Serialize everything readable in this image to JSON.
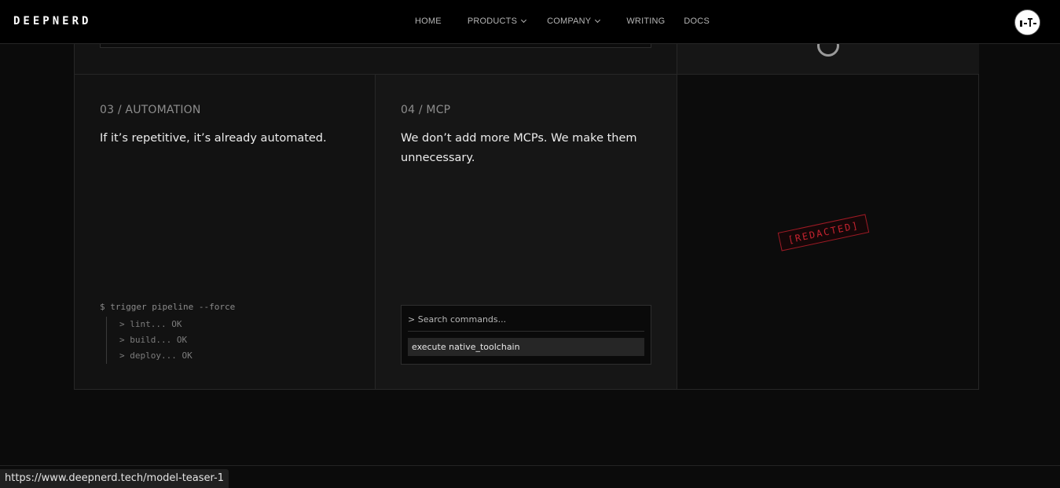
{
  "brand": {
    "logo_text": "DEEPNERD"
  },
  "nav": {
    "items": [
      {
        "label": "HOME",
        "dropdown": false
      },
      {
        "label": "PRODUCTS",
        "dropdown": true
      },
      {
        "label": "COMPANY",
        "dropdown": true
      },
      {
        "label": "WRITING",
        "dropdown": false
      },
      {
        "label": "DOCS",
        "dropdown": false
      }
    ],
    "avatar_icon": "user-avatar-icon"
  },
  "cards": [
    {
      "eyebrow": "03 / AUTOMATION",
      "title": "If it’s repetitive, it’s already automated.",
      "terminal": {
        "command": "$ trigger pipeline --force",
        "steps": [
          "> lint... OK",
          "> build... OK",
          "> deploy... OK"
        ]
      }
    },
    {
      "eyebrow": "04 / MCP",
      "title": "We don’t add more MCPs. We make them unnecessary.",
      "palette": {
        "placeholder": "> Search commands...",
        "item": "execute native_toolchain"
      }
    },
    {
      "stamp": "[REDACTED]"
    }
  ],
  "colors": {
    "background": "#0b0b0b",
    "stamp_red": "#c4232f"
  },
  "status_bar": {
    "url": "https://www.deepnerd.tech/model-teaser-1"
  }
}
